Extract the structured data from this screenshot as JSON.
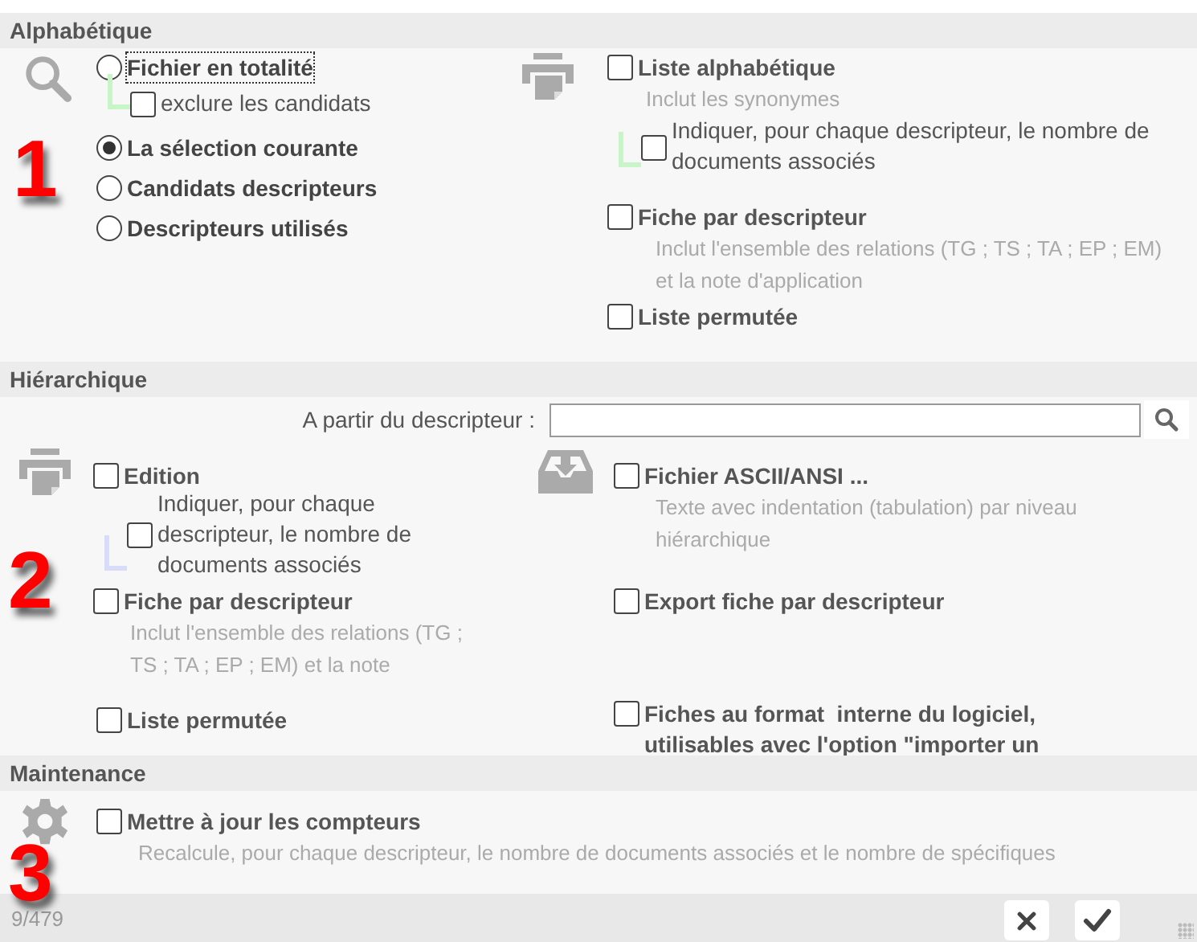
{
  "alphabetique": {
    "title": "Alphabétique",
    "scope_options": [
      {
        "label": "Fichier en totalité",
        "selected": false,
        "focused": true,
        "children": [
          {
            "label": "exclure les candidats",
            "checked": false
          }
        ]
      },
      {
        "label": "La sélection courante",
        "selected": true,
        "focused": false
      },
      {
        "label": "Candidats descripteurs",
        "selected": false,
        "focused": false
      },
      {
        "label": "Descripteurs utilisés",
        "selected": false,
        "focused": false
      }
    ],
    "print_options": [
      {
        "label": "Liste alphabétique",
        "checked": false,
        "hint": "Inclut les synonymes",
        "children": [
          {
            "label": "Indiquer, pour chaque descripteur, le nombre de documents associés",
            "checked": false
          }
        ]
      },
      {
        "label": "Fiche par descripteur",
        "checked": false,
        "hint": "Inclut l'ensemble des relations (TG ; TS ; TA ; EP ; EM) et la note d'application"
      },
      {
        "label": "Liste permutée",
        "checked": false
      }
    ]
  },
  "hierarchique": {
    "title": "Hiérarchique",
    "start_field": {
      "label": "A partir du descripteur :"
    },
    "print_options": [
      {
        "label": "Edition",
        "checked": false,
        "children": [
          {
            "label": "Indiquer, pour chaque descripteur, le nombre de documents associés",
            "checked": false
          }
        ]
      },
      {
        "label": "Fiche par descripteur",
        "checked": false,
        "hint": "Inclut l'ensemble des relations (TG ; TS ; TA ; EP ; EM) et la note"
      },
      {
        "label": "Liste permutée",
        "checked": false
      }
    ],
    "export_options": [
      {
        "label": "Fichier ASCII/ANSI ...",
        "checked": false,
        "hint": "Texte avec indentation (tabulation) par niveau hiérarchique"
      },
      {
        "label": "Export fiche par descripteur",
        "checked": false
      },
      {
        "label": "Fiches au format  interne du logiciel, utilisables avec l'option \"importer un",
        "checked": false
      }
    ]
  },
  "maintenance": {
    "title": "Maintenance",
    "options": [
      {
        "label": "Mettre à jour les compteurs",
        "checked": false,
        "hint": "Recalcule, pour chaque descripteur, le nombre de documents associés et le nombre de spécifiques"
      }
    ]
  },
  "footer": {
    "counter": "9/479",
    "buttons": [
      {
        "kind": "cancel"
      },
      {
        "kind": "confirm"
      }
    ]
  },
  "annotations": [
    "1",
    "2",
    "3"
  ]
}
